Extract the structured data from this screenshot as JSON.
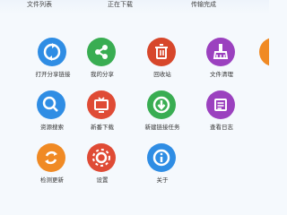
{
  "top_tabs": [
    "文件列表",
    "正在下载",
    "传输完成"
  ],
  "grid": {
    "open_share": {
      "label": "打开分享链接",
      "color": "#2f8de4",
      "icon": "refresh-icon"
    },
    "my_share": {
      "label": "我的分享",
      "color": "#39ad52",
      "icon": "share-icon"
    },
    "recycle": {
      "label": "回收站",
      "color": "#d7472b",
      "icon": "trash-icon"
    },
    "file_cleanup": {
      "label": "文件清理",
      "color": "#9b41bf",
      "icon": "broom-icon"
    },
    "partial_top": {
      "label": "",
      "color": "#f08a24"
    },
    "resource_search": {
      "label": "资源搜索",
      "color": "#2f8de4",
      "icon": "search-icon"
    },
    "new_download": {
      "label": "新番下载",
      "color": "#df4b35",
      "icon": "tv-icon"
    },
    "new_link_task": {
      "label": "新建链接任务",
      "color": "#39ad52",
      "icon": "download-icon"
    },
    "view_log": {
      "label": "查看日志",
      "color": "#9b41bf",
      "icon": "list-icon"
    },
    "check_update": {
      "label": "检测更新",
      "color": "#f08a24",
      "icon": "sync-icon"
    },
    "settings": {
      "label": "设置",
      "color": "#df4b35",
      "icon": "gear-icon"
    },
    "about": {
      "label": "关于",
      "color": "#2f8de4",
      "icon": "info-icon"
    }
  }
}
